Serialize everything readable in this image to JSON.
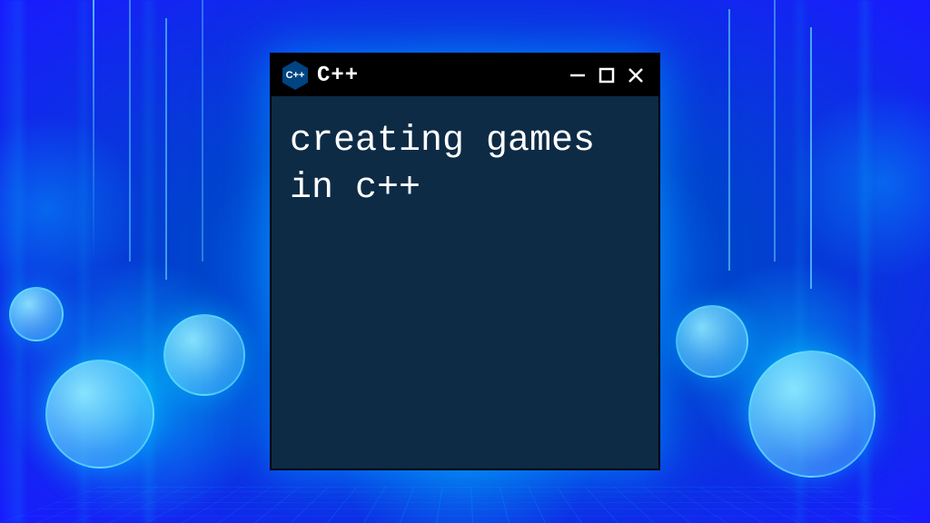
{
  "window": {
    "app_icon_label": "C++",
    "title": "C++",
    "controls": {
      "minimize": "minimize",
      "maximize": "maximize",
      "close": "close"
    }
  },
  "terminal": {
    "content": "creating games in c++"
  },
  "colors": {
    "terminal_bg": "#0d2b45",
    "titlebar_bg": "#000000",
    "text": "#ffffff",
    "glow": "#00c8ff"
  }
}
